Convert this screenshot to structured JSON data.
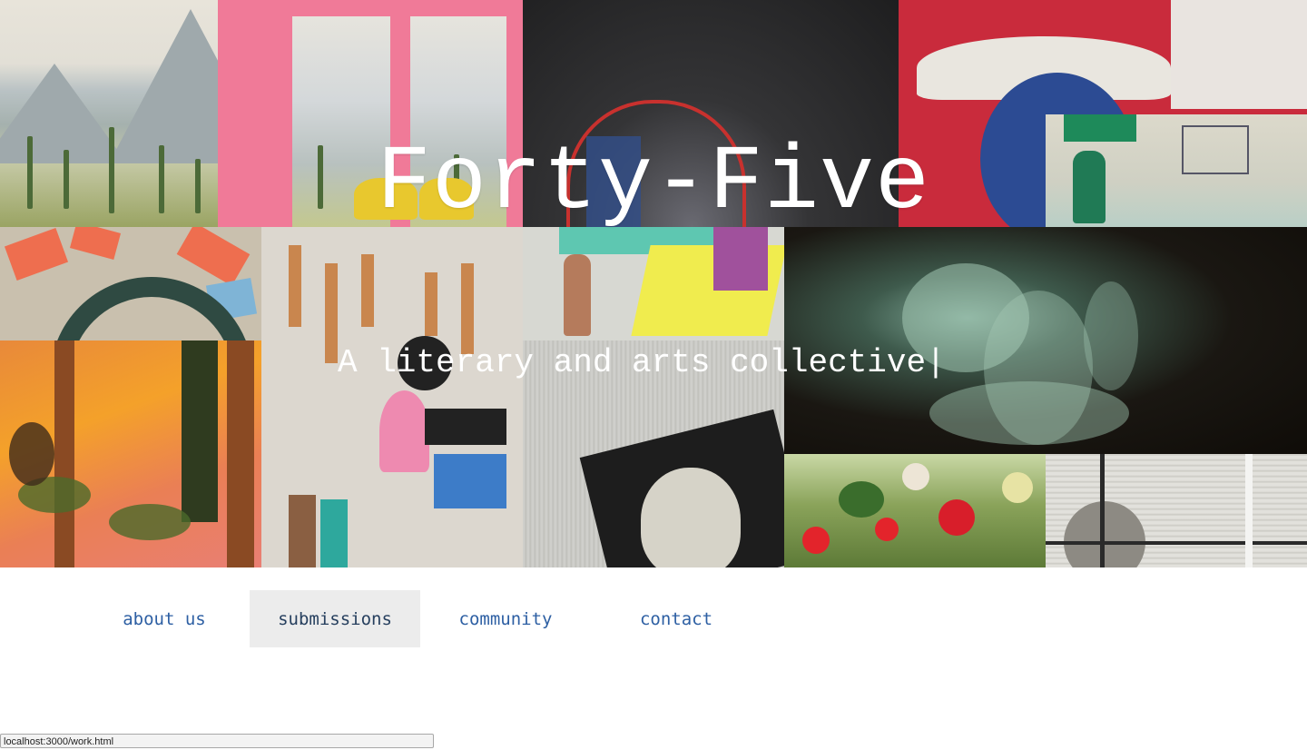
{
  "hero": {
    "title": "Forty-Five",
    "subtitle": "A literary and arts collective",
    "cursor": "|"
  },
  "nav": {
    "items": [
      {
        "label": "about us",
        "active": false
      },
      {
        "label": "submissions",
        "active": true
      },
      {
        "label": "community",
        "active": false
      },
      {
        "label": "contact",
        "active": false
      }
    ]
  },
  "status_bar": {
    "url": "localhost:3000/work.html"
  },
  "colors": {
    "nav_link": "#2d5fa3",
    "nav_active_bg": "#ececec",
    "hero_text": "#ffffff"
  }
}
